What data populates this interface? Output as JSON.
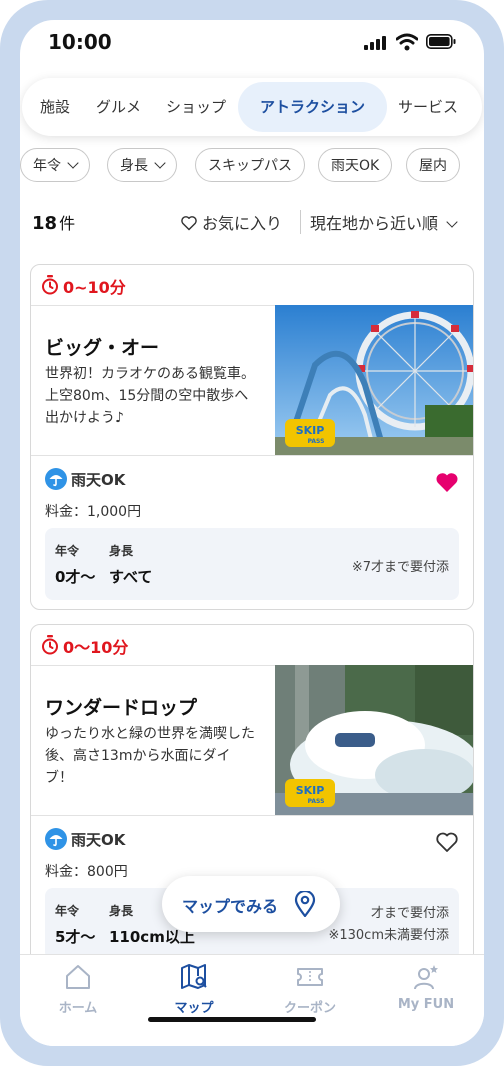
{
  "status_bar": {
    "time": "10:00"
  },
  "tabs": [
    {
      "label": "施設",
      "active": false
    },
    {
      "label": "グルメ",
      "active": false
    },
    {
      "label": "ショップ",
      "active": false
    },
    {
      "label": "アトラクション",
      "active": true
    },
    {
      "label": "サービス",
      "active": false
    }
  ],
  "filters": [
    {
      "label": "年令",
      "dropdown": true
    },
    {
      "label": "身長",
      "dropdown": true
    },
    {
      "label": "スキップパス",
      "dropdown": false
    },
    {
      "label": "雨天OK",
      "dropdown": false
    },
    {
      "label": "屋内",
      "dropdown": false
    }
  ],
  "results": {
    "count": "18",
    "unit": "件",
    "favorites_label": "お気に入り",
    "sort_label": "現在地から近い順"
  },
  "cards": [
    {
      "wait_time": "0~10分",
      "title": "ビッグ・オー",
      "description": "世界初！カラオケのある観覧車。上空80m、15分間の空中散歩へ出かけよう♪",
      "weather": "雨天OK",
      "fee": "料金：1,000円",
      "favorited": true,
      "age_header": "年令",
      "age_value": "0才〜",
      "height_header": "身長",
      "height_value": "すべて",
      "notes": [
        "※7才まで要付添"
      ]
    },
    {
      "wait_time": "0〜10分",
      "title": "ワンダードロップ",
      "description": "ゆったり水と緑の世界を満喫した後、高さ13mから水面にダイブ！",
      "weather": "雨天OK",
      "fee": "料金：800円",
      "favorited": false,
      "age_header": "年令",
      "age_value": "5才〜",
      "height_header": "身長",
      "height_value": "110cm以上",
      "notes": [
        "才まで要付添",
        "※130cm未満要付添"
      ]
    }
  ],
  "map_button": {
    "label": "マップでみる"
  },
  "bottom_nav": [
    {
      "label": "ホーム",
      "icon": "home-icon",
      "active": false
    },
    {
      "label": "マップ",
      "icon": "map-icon",
      "active": true
    },
    {
      "label": "クーポン",
      "icon": "coupon-icon",
      "active": false
    },
    {
      "label": "My FUN",
      "icon": "user-star-icon",
      "active": false
    }
  ],
  "colors": {
    "accent": "#1d4fa0",
    "wait_red": "#e0161e",
    "heart_pink": "#e6006e",
    "frame": "#c9d9ee"
  }
}
